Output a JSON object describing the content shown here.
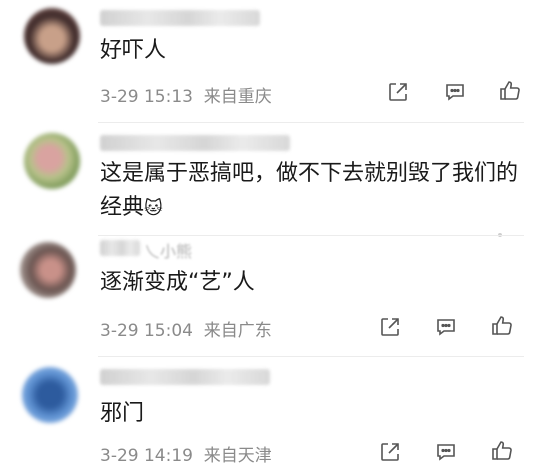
{
  "comments": [
    {
      "text": "好吓人",
      "date": "3-29 15:13",
      "location": "来自重庆"
    },
    {
      "text": "这是属于恶搞吧，做不下去就别毁了我们的",
      "text2": "经典",
      "emoji": "🐱"
    },
    {
      "partial_name": "乀小熊",
      "text": "逐渐变成“艺”人",
      "date": "3-29 15:04",
      "location": "来自广东"
    },
    {
      "text": "邪门",
      "date": "3-29 14:19",
      "location": "来自天津"
    }
  ]
}
